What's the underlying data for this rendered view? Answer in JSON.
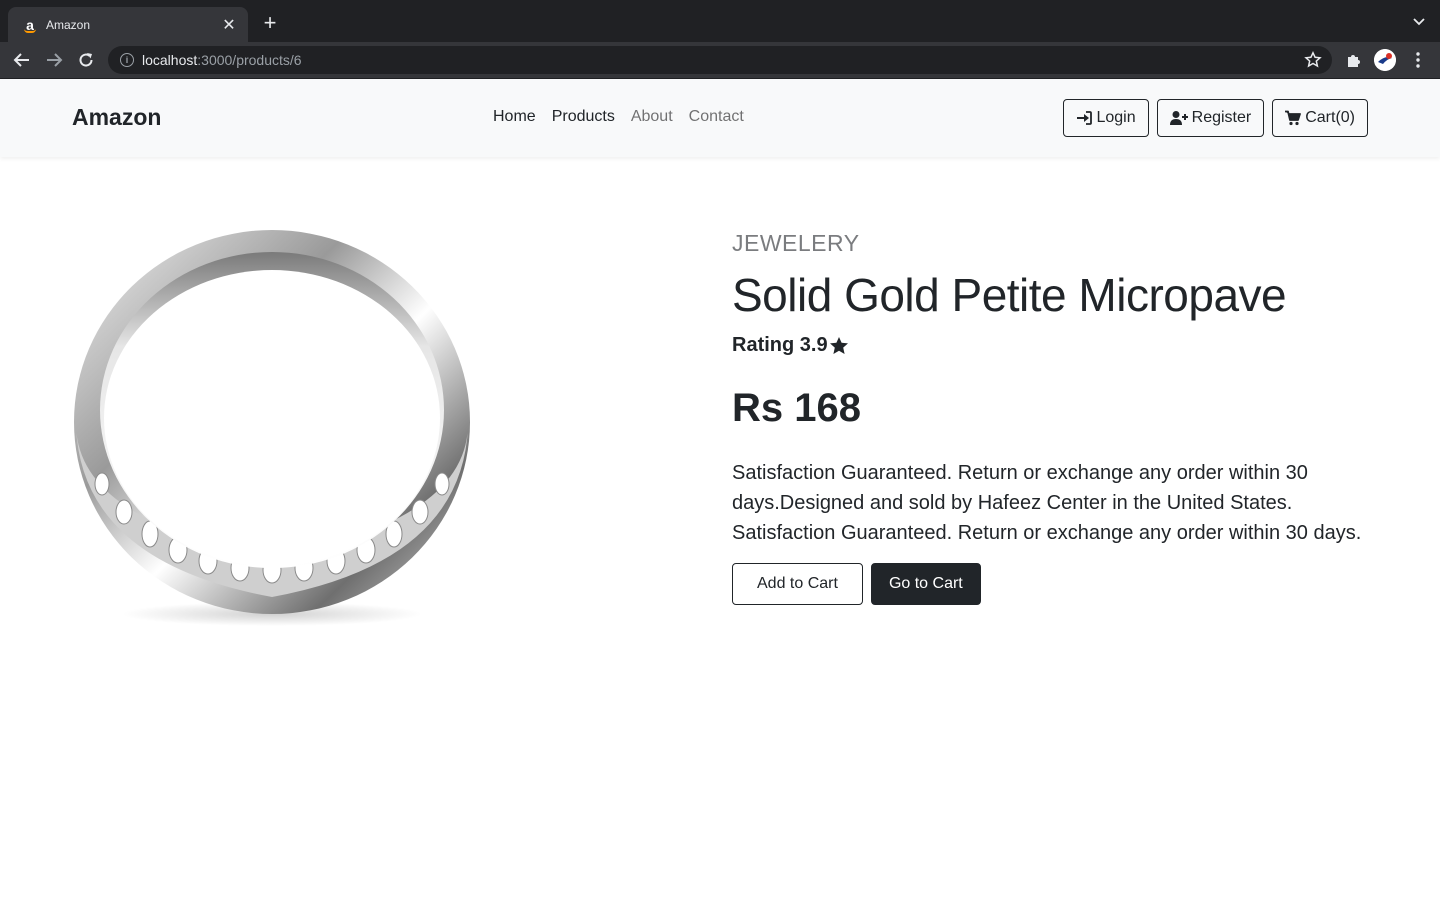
{
  "browser": {
    "tab_title": "Amazon",
    "url_host": "localhost",
    "url_path": ":3000/products/6"
  },
  "navbar": {
    "brand": "Amazon",
    "links": [
      "Home",
      "Products",
      "About",
      "Contact"
    ],
    "login_label": "Login",
    "register_label": "Register",
    "cart_label": "Cart(0)"
  },
  "product": {
    "category": "JEWELERY",
    "title": "Solid Gold Petite Micropave",
    "rating_label": "Rating 3.9",
    "price": "Rs 168",
    "description": "Satisfaction Guaranteed. Return or exchange any order within 30 days.Designed and sold by Hafeez Center in the United States. Satisfaction Guaranteed. Return or exchange any order within 30 days.",
    "add_to_cart_label": "Add to Cart",
    "go_to_cart_label": "Go to Cart"
  },
  "colors": {
    "chrome_dark": "#202124",
    "chrome_mid": "#35363a",
    "navbar_bg": "#f8f9fa",
    "text_dark": "#212529"
  },
  "icons": {
    "login": "sign-in-icon",
    "register": "user-plus-icon",
    "cart": "shopping-cart-icon",
    "rating": "star-icon"
  }
}
